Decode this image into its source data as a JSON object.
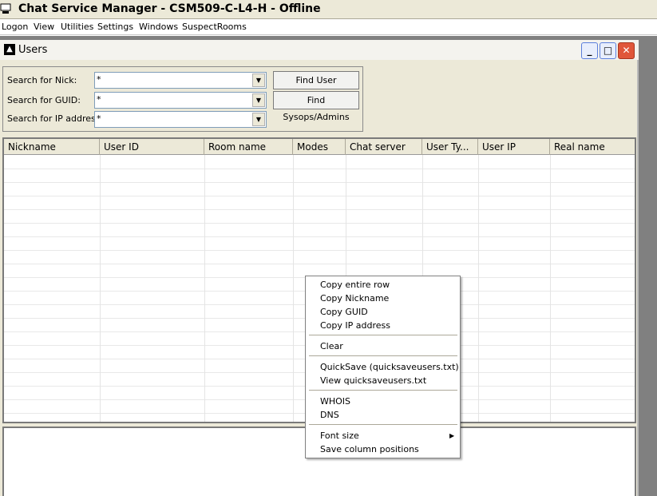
{
  "app": {
    "title": "Chat Service Manager - CSM509-C-L4-H - Offline"
  },
  "menubar": [
    "Logon",
    "View",
    "Utilities",
    "Settings",
    "Windows",
    "SuspectRooms"
  ],
  "window": {
    "title": "Users"
  },
  "search": {
    "nick_label": "Search for Nick:",
    "nick_value": "*",
    "guid_label": "Search for GUID:",
    "guid_value": "*",
    "ip_label": "Search for IP address:",
    "ip_value": "*",
    "find_user": "Find User",
    "find_sysops": "Find Sysops/Admins"
  },
  "columns": [
    "Nickname",
    "User ID",
    "Room name",
    "Modes",
    "Chat server",
    "User Ty...",
    "User IP",
    "Real name"
  ],
  "context_menu": {
    "items": [
      "Copy entire row",
      "Copy Nickname",
      "Copy GUID",
      "Copy IP address",
      "Clear",
      "QuickSave (quicksaveusers.txt)",
      "View quicksaveusers.txt",
      "WHOIS",
      "DNS",
      "Font size",
      "Save column positions"
    ]
  }
}
